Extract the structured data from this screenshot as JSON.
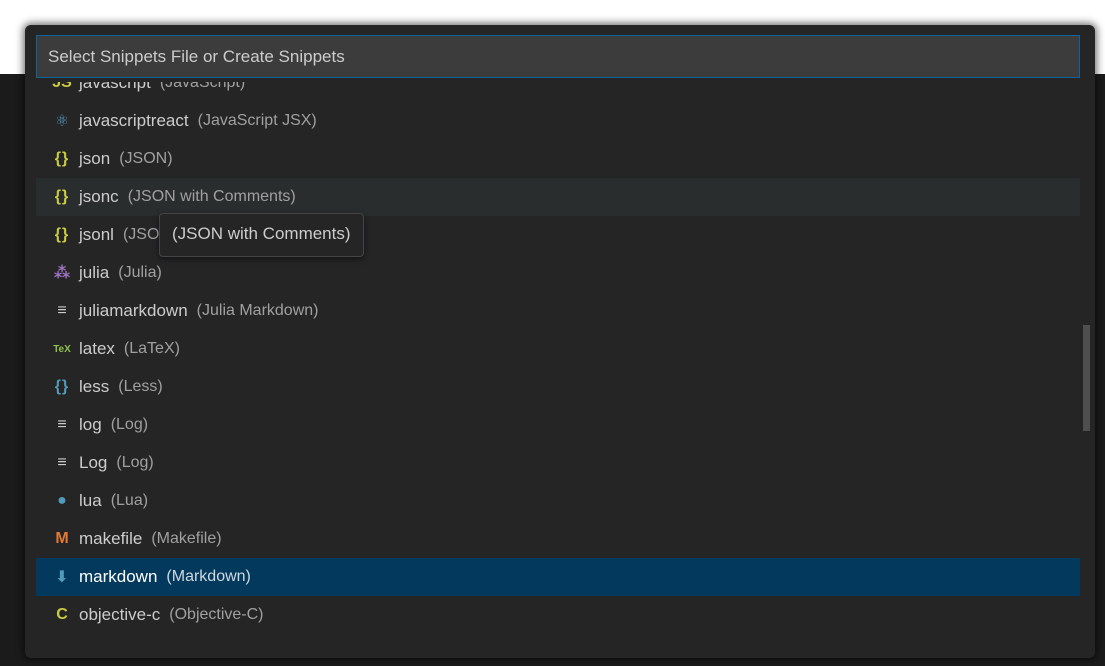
{
  "search": {
    "placeholder": "Select Snippets File or Create Snippets"
  },
  "items": [
    {
      "name": "javascript",
      "desc": "(JavaScript)",
      "icon": "js-icon",
      "glyph": "JS",
      "color": "#cbcb41"
    },
    {
      "name": "javascriptreact",
      "desc": "(JavaScript JSX)",
      "icon": "react-icon",
      "glyph": "⚛",
      "color": "#519aba"
    },
    {
      "name": "json",
      "desc": "(JSON)",
      "icon": "braces-icon",
      "glyph": "{}",
      "color": "#cbcb41"
    },
    {
      "name": "jsonc",
      "desc": "(JSON with Comments)",
      "icon": "braces-icon",
      "glyph": "{}",
      "color": "#cbcb41"
    },
    {
      "name": "jsonl",
      "desc": "(JSON Lines)",
      "icon": "braces-icon",
      "glyph": "{}",
      "color": "#cbcb41"
    },
    {
      "name": "julia",
      "desc": "(Julia)",
      "icon": "julia-icon",
      "glyph": "⁂",
      "color": "#a074c4"
    },
    {
      "name": "juliamarkdown",
      "desc": "(Julia Markdown)",
      "icon": "lines-icon",
      "glyph": "≡",
      "color": "#cccccc"
    },
    {
      "name": "latex",
      "desc": "(LaTeX)",
      "icon": "tex-icon",
      "glyph": "TeX",
      "color": "#8dc149"
    },
    {
      "name": "less",
      "desc": "(Less)",
      "icon": "braces-icon",
      "glyph": "{}",
      "color": "#519aba"
    },
    {
      "name": "log",
      "desc": "(Log)",
      "icon": "lines-icon",
      "glyph": "≡",
      "color": "#cccccc"
    },
    {
      "name": "Log",
      "desc": "(Log)",
      "icon": "lines-icon",
      "glyph": "≡",
      "color": "#cccccc"
    },
    {
      "name": "lua",
      "desc": "(Lua)",
      "icon": "lua-icon",
      "glyph": "●",
      "color": "#519aba"
    },
    {
      "name": "makefile",
      "desc": "(Makefile)",
      "icon": "makefile-icon",
      "glyph": "M",
      "color": "#e37933"
    },
    {
      "name": "markdown",
      "desc": "(Markdown)",
      "icon": "markdown-icon",
      "glyph": "⬇",
      "color": "#519aba"
    },
    {
      "name": "objective-c",
      "desc": "(Objective-C)",
      "icon": "c-icon",
      "glyph": "C",
      "color": "#cbcb41"
    }
  ],
  "hover_index": 3,
  "selected_index": 13,
  "tooltip": {
    "text": "(JSON with Comments)"
  },
  "colors": {
    "accent": "#0e639c",
    "selection": "#04395e",
    "hover": "#2a2d2e",
    "background": "#252526"
  }
}
